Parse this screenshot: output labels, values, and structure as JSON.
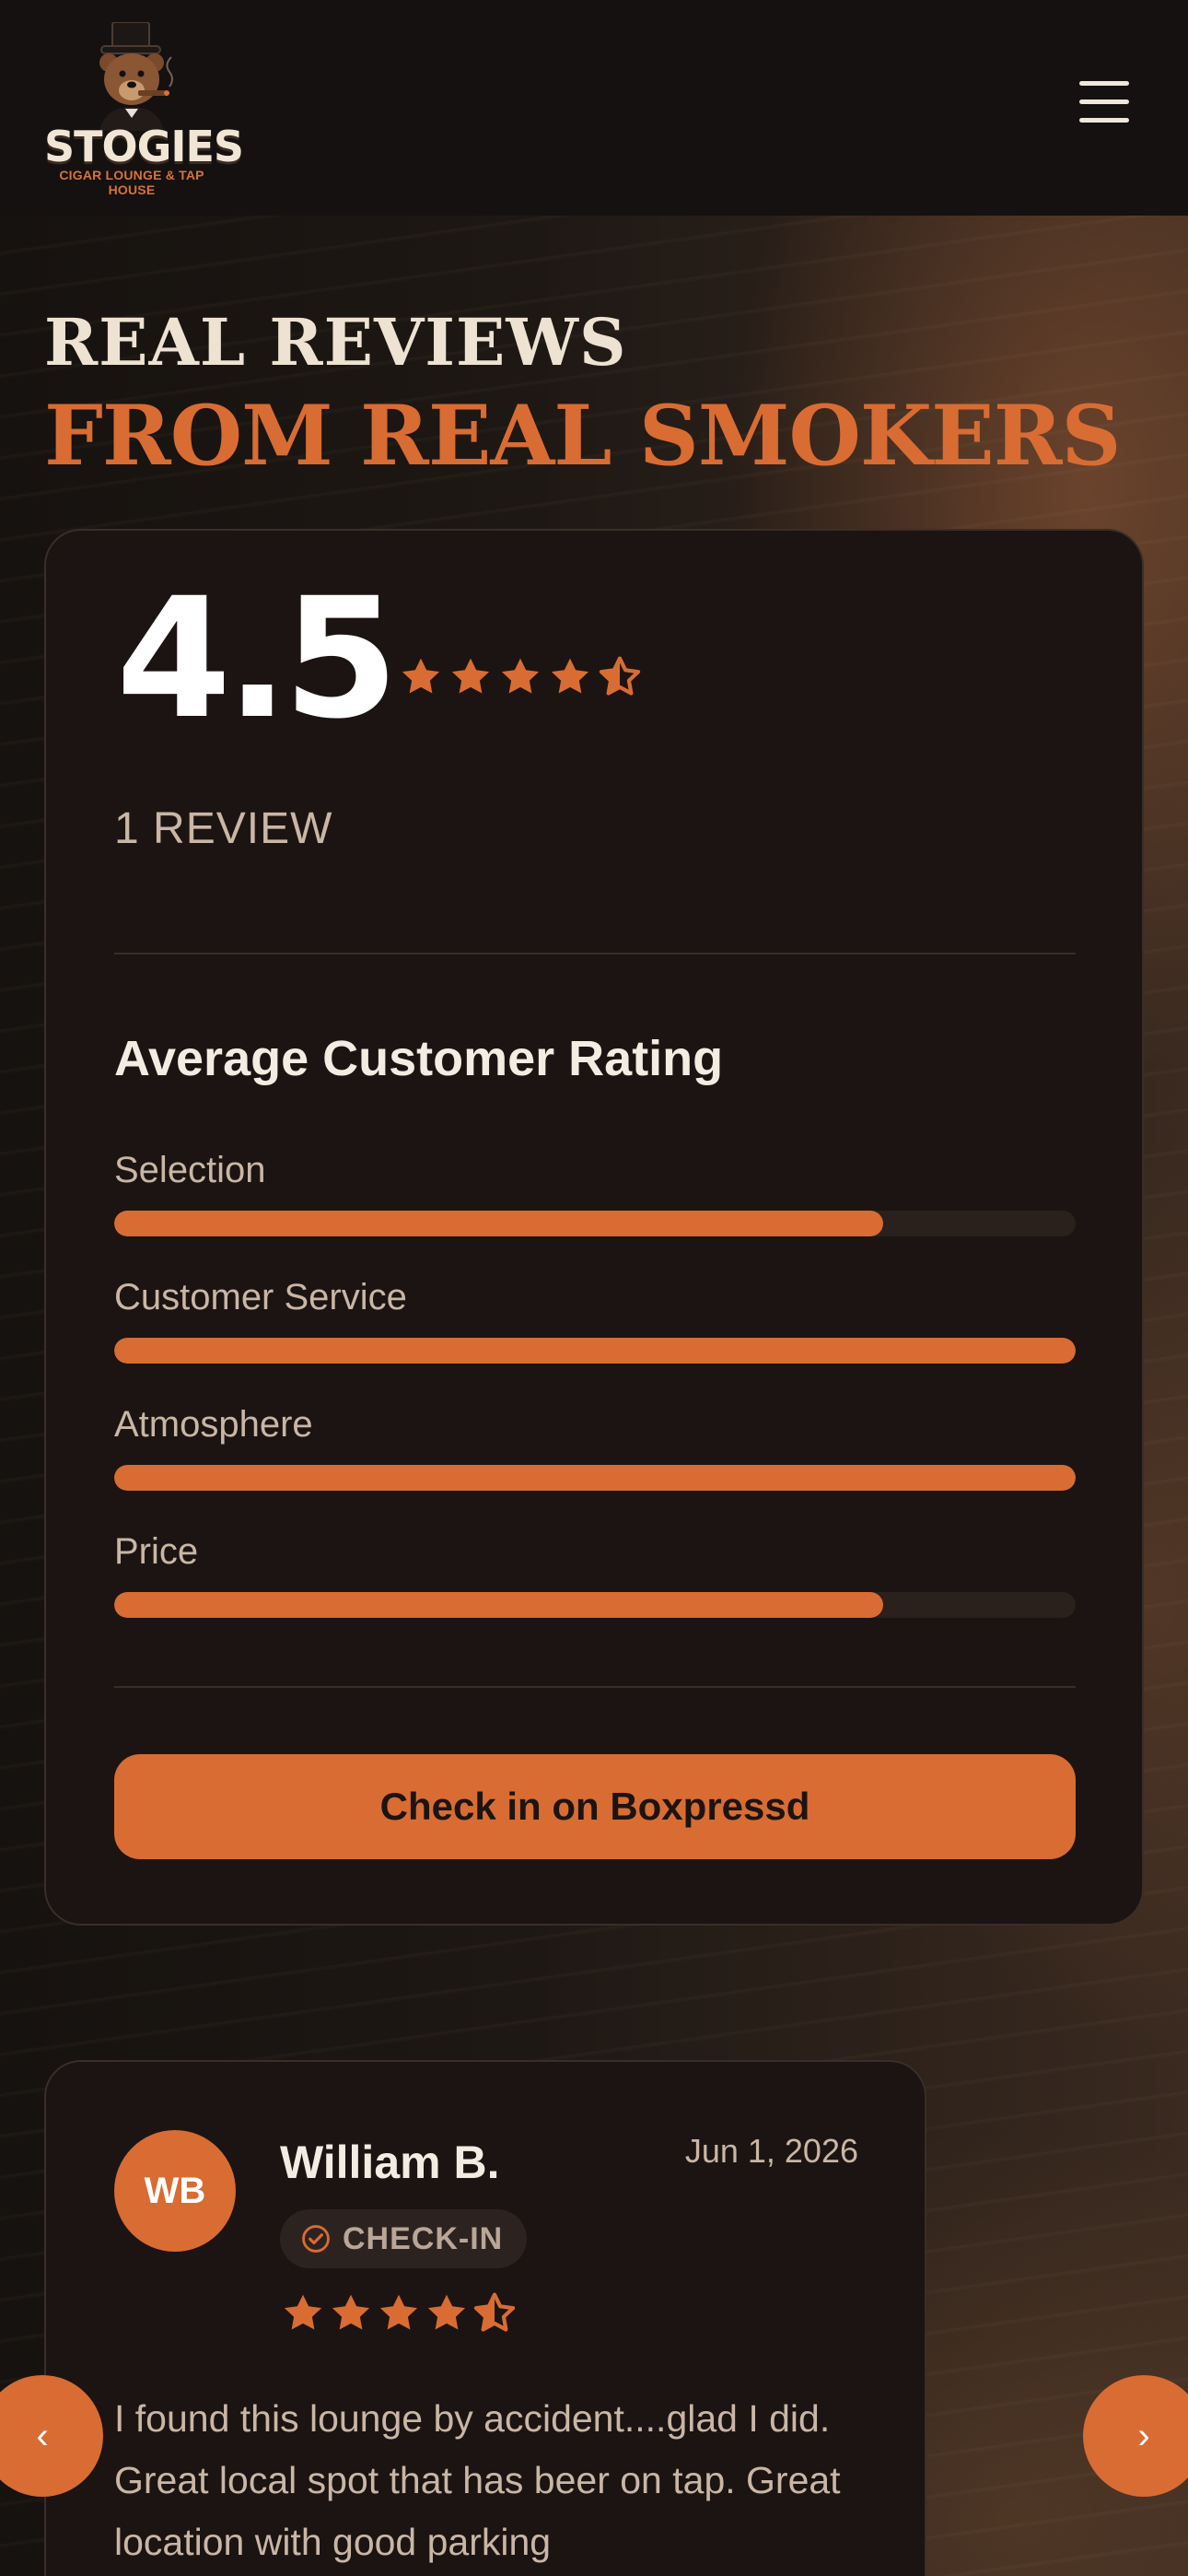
{
  "header": {
    "brand": "STOGIES",
    "tagline": "CIGAR LOUNGE & TAP HOUSE",
    "menu_icon": "hamburger-menu-icon"
  },
  "section": {
    "heading_line1": "REAL REVIEWS",
    "heading_line2": "FROM REAL SMOKERS"
  },
  "summary": {
    "score": "4.5",
    "stars": 4.5,
    "review_count": "1 REVIEW",
    "avg_title": "Average Customer Rating",
    "ratings": [
      {
        "label": "Selection",
        "fraction": 0.8
      },
      {
        "label": "Customer Service",
        "fraction": 1.0
      },
      {
        "label": "Atmosphere",
        "fraction": 1.0
      },
      {
        "label": "Price",
        "fraction": 0.8
      }
    ],
    "button_label": "Check in on Boxpressd"
  },
  "review": {
    "initials": "WB",
    "name": "William B.",
    "date": "Jun 1, 2026",
    "badge": "CHECK-IN",
    "badge_icon": "check-circle-icon",
    "stars": 4.5,
    "text": "I found this lounge by accident....glad I did. Great local spot that has beer on tap. Great location with good parking"
  },
  "carousel": {
    "prev_icon": "chevron-left-icon",
    "next_icon": "chevron-right-icon",
    "prev_glyph": "‹",
    "next_glyph": "›"
  },
  "colors": {
    "accent": "#d86c33",
    "card": "#1c1412",
    "text_muted": "#c9b6a6"
  }
}
